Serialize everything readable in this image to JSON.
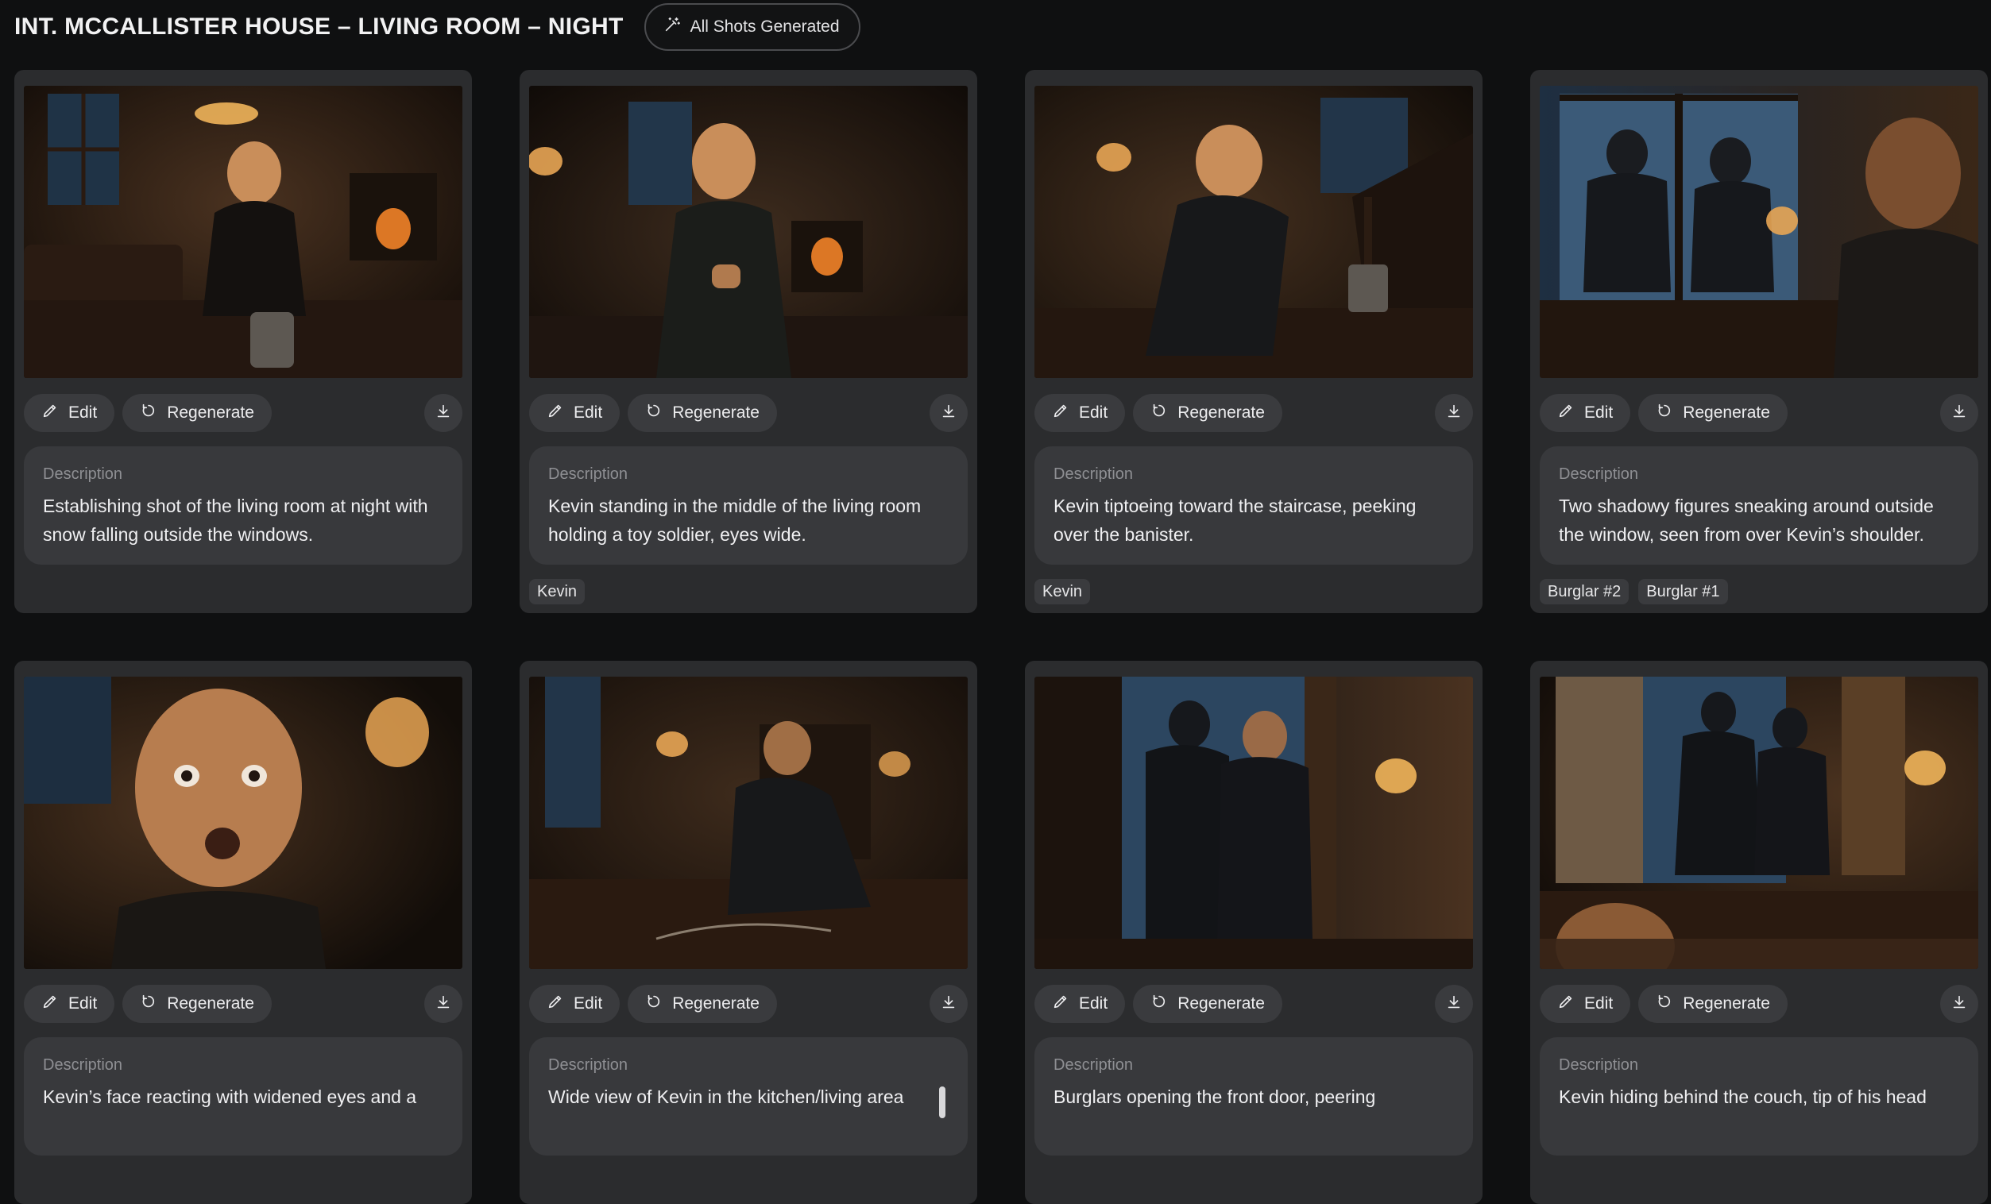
{
  "header": {
    "scene_title": "INT. MCCALLISTER HOUSE – LIVING ROOM – NIGHT",
    "status_label": "All Shots Generated"
  },
  "labels": {
    "edit": "Edit",
    "regenerate": "Regenerate",
    "description": "Description"
  },
  "shots": [
    {
      "description": "Establishing shot of the living room at night with snow falling outside the windows.",
      "tags": []
    },
    {
      "description": "Kevin standing in the middle of the living room holding a toy soldier, eyes wide.",
      "tags": [
        "Kevin"
      ]
    },
    {
      "description": "Kevin tiptoeing toward the staircase, peeking over the banister.",
      "tags": [
        "Kevin"
      ]
    },
    {
      "description": "Two shadowy figures sneaking around outside the window, seen from over Kevin’s shoulder.",
      "tags": [
        "Burglar #2",
        "Burglar #1"
      ]
    },
    {
      "description": "Kevin’s face reacting with widened eyes and a",
      "tags": []
    },
    {
      "description": "Wide view of Kevin in the kitchen/living area",
      "tags": []
    },
    {
      "description": "Burglars opening the front door, peering",
      "tags": []
    },
    {
      "description": "Kevin hiding behind the couch, tip of his head",
      "tags": []
    }
  ]
}
